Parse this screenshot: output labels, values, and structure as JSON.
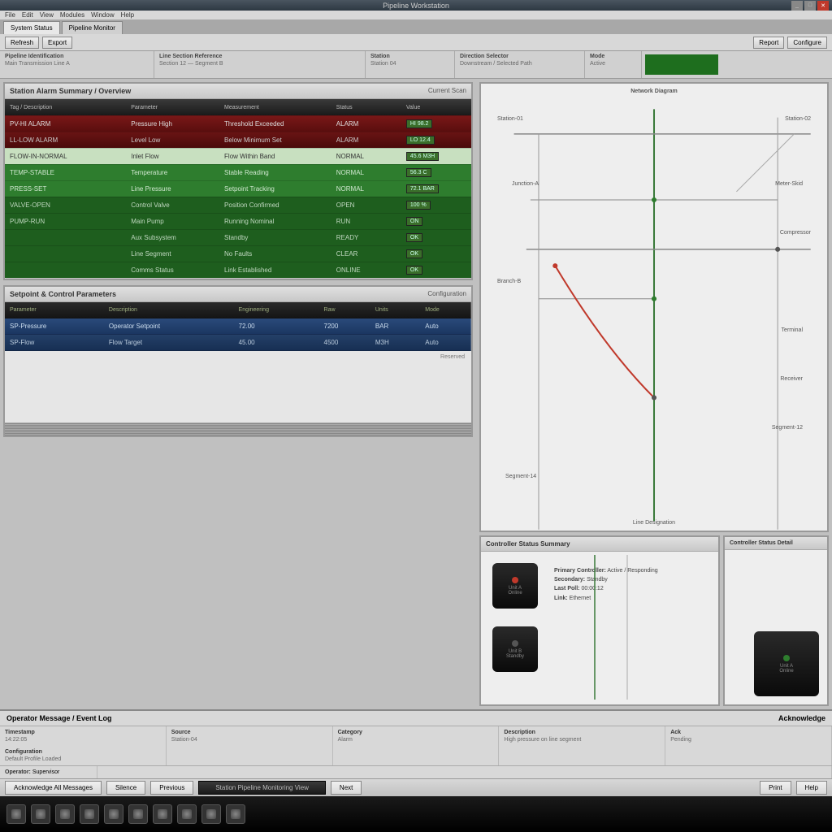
{
  "title": "Pipeline Workstation",
  "menu": [
    "File",
    "Edit",
    "View",
    "Modules",
    "Window",
    "Help"
  ],
  "tabs": [
    "System Status",
    "Pipeline Monitor"
  ],
  "toolbar": {
    "refresh": "Refresh",
    "export": "Export",
    "btn_a": "Report",
    "btn_b": "Configure"
  },
  "summary": [
    {
      "label": "Pipeline Identification",
      "val": "Main Transmission Line A"
    },
    {
      "label": "Line Section Reference",
      "val": "Section 12 — Segment B"
    },
    {
      "label": "Station",
      "val": "Station 04"
    },
    {
      "label": "Direction Selector",
      "val": "Downstream / Selected Path"
    },
    {
      "label": "Mode",
      "val": "Active"
    }
  ],
  "panel1": {
    "title": "Station Alarm Summary / Overview",
    "sub": "Current Scan",
    "headers": [
      "Tag / Description",
      "Parameter",
      "Measurement",
      "Status",
      "Value"
    ],
    "rows": [
      {
        "cls": "alert-red",
        "c": [
          "PV-HI ALARM",
          "Pressure High",
          "Threshold Exceeded",
          "ALARM",
          "HI 98.2"
        ]
      },
      {
        "cls": "alert-red2",
        "c": [
          "LL-LOW ALARM",
          "Level Low",
          "Below Minimum Set",
          "ALARM",
          "LO 12.4"
        ]
      },
      {
        "cls": "ok-lightgreen",
        "c": [
          "FLOW-IN-NORMAL",
          "Inlet Flow",
          "Flow Within Band",
          "NORMAL",
          "45.6 M3H"
        ]
      },
      {
        "cls": "ok-green",
        "c": [
          "TEMP-STABLE",
          "Temperature",
          "Stable Reading",
          "NORMAL",
          "56.3 C"
        ]
      },
      {
        "cls": "ok-green",
        "c": [
          "PRESS-SET",
          "Line Pressure",
          "Setpoint Tracking",
          "NORMAL",
          "72.1 BAR"
        ]
      },
      {
        "cls": "ok-darkgreen",
        "c": [
          "VALVE-OPEN",
          "Control Valve",
          "Position Confirmed",
          "OPEN",
          "100 %"
        ]
      },
      {
        "cls": "ok-darkgreen",
        "c": [
          "PUMP-RUN",
          "Main Pump",
          "Running Nominal",
          "RUN",
          "ON"
        ]
      },
      {
        "cls": "ok-darkgreen",
        "c": [
          "",
          "Aux Subsystem",
          "Standby",
          "READY",
          "OK"
        ]
      },
      {
        "cls": "ok-darkgreen",
        "c": [
          "",
          "Line Segment",
          "No Faults",
          "CLEAR",
          "OK"
        ]
      },
      {
        "cls": "ok-darkgreen",
        "c": [
          "",
          "Comms Status",
          "Link Established",
          "ONLINE",
          "OK"
        ]
      }
    ]
  },
  "panel2": {
    "title": "Setpoint & Control Parameters",
    "sub": "Configuration",
    "headers": [
      "Parameter",
      "Description",
      "Engineering",
      "Raw",
      "Units",
      "Mode"
    ],
    "rows": [
      {
        "c": [
          "SP-Pressure",
          "Operator Setpoint",
          "72.00",
          "7200",
          "BAR",
          "Auto"
        ]
      },
      {
        "c": [
          "SP-Flow",
          "Flow Target",
          "45.00",
          "4500",
          "M3H",
          "Auto"
        ]
      }
    ]
  },
  "blank_label": "Reserved",
  "diagram": {
    "title_top": "Network Diagram",
    "labels": {
      "n1": "Station-01",
      "n2": "Station-02",
      "n3": "Junction-A",
      "n4": "Meter-Skid",
      "n5": "Compressor",
      "n6": "Branch-B",
      "n7": "Terminal",
      "n8": "Receiver",
      "n9": "Segment-12",
      "n10": "Segment-14",
      "n11": "Line Designation"
    }
  },
  "lower": {
    "title": "Controller Status Summary",
    "right_title": "Controller Status Detail",
    "db1_label": "Unit A",
    "db1_sub": "Online",
    "db2_label": "Unit B",
    "db2_sub": "Standby",
    "fields": [
      {
        "l": "Primary Controller",
        "v": "Active / Responding"
      },
      {
        "l": "Secondary",
        "v": "Standby"
      },
      {
        "l": "Last Poll",
        "v": "00:00:12"
      },
      {
        "l": "Link",
        "v": "Ethernet"
      }
    ]
  },
  "bottom": {
    "title": "Operator Message / Event Log",
    "right": "Acknowledge",
    "rows": [
      [
        {
          "l": "Timestamp",
          "v": "14:22:05"
        },
        {
          "l": "Source",
          "v": "Station-04"
        },
        {
          "l": "Category",
          "v": "Alarm"
        },
        {
          "l": "Description",
          "v": "High pressure on line segment"
        },
        {
          "l": "Ack",
          "v": "Pending"
        }
      ],
      [
        {
          "l": "Configuration",
          "v": "Default Profile Loaded"
        },
        {
          "l": "",
          "v": ""
        },
        {
          "l": "",
          "v": ""
        },
        {
          "l": "",
          "v": ""
        },
        {
          "l": "",
          "v": ""
        }
      ]
    ],
    "footer_label": "Operator:",
    "footer_val": "Supervisor"
  },
  "statusbar": {
    "b1": "Acknowledge All Messages",
    "b2": "Silence",
    "b3": "Previous",
    "dark": "Station Pipeline Monitoring View",
    "b4": "Next",
    "b5": "Print",
    "b6": "Help"
  },
  "window_ctrl": {
    "min": "_",
    "max": "□",
    "close": "✕"
  }
}
